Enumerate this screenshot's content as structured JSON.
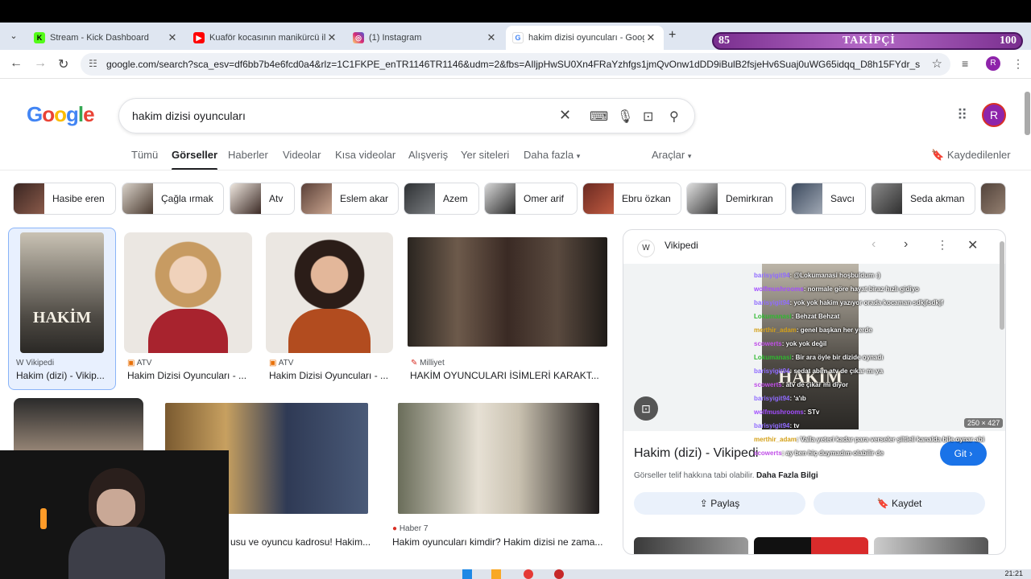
{
  "browser": {
    "tabs": [
      {
        "label": "Stream - Kick Dashboard",
        "icon": "kick-icon",
        "color": "#53fc18"
      },
      {
        "label": "Kuaför kocasının manikürcü ile...",
        "icon": "youtube-icon",
        "color": "#ff0000"
      },
      {
        "label": "(1) Instagram",
        "icon": "instagram-icon",
        "color": "#d6249f"
      },
      {
        "label": "hakim dizisi oyuncuları - Googl...",
        "icon": "google-icon",
        "color": "#4285f4"
      }
    ],
    "url": "google.com/search?sca_esv=df6bb7b4e6fcd0a4&rlz=1C1FKPE_enTR1146TR1146&udm=2&fbs=AIljpHwSU0Xn4FRaYzhfgs1jmQvOnw1dDD9iBulB2fsjeHv6Suaj0uWG65idqq_D8h15FYdr_s8gfpDi9...",
    "profile_initial": "R"
  },
  "follower_overlay": {
    "left": "85",
    "label": "TAKİPÇİ",
    "right": "100",
    "progress": 0.85
  },
  "google": {
    "logo": "Google",
    "query": "hakim dizisi oyuncuları",
    "avatar_initial": "R",
    "filters": [
      "Tümü",
      "Görseller",
      "Haberler",
      "Videolar",
      "Kısa videolar",
      "Alışveriş",
      "Yer siteleri",
      "Daha fazla"
    ],
    "tools": "Araçlar",
    "saved": "Kaydedilenler",
    "chips": [
      "Hasibe eren",
      "Çağla ırmak",
      "Atv",
      "Eslem akar",
      "Azem",
      "Omer arif",
      "Ebru özkan",
      "Demirkıran",
      "Savcı",
      "Seda akman"
    ],
    "results": [
      {
        "source": "Vikipedi",
        "title": "Hakim (dizi) - Vikip..."
      },
      {
        "source": "ATV",
        "title": "Hakim Dizisi Oyuncuları - ..."
      },
      {
        "source": "ATV",
        "title": "Hakim Dizisi Oyuncuları - ..."
      },
      {
        "source": "Milliyet",
        "title": "HAKİM OYUNCULARI İSİMLERİ KARAKT..."
      },
      {
        "source": "",
        "title": "usu ve oyuncu kadrosu! Hakim..."
      },
      {
        "source": "Haber 7",
        "title": "Hakim oyuncuları kimdir? Hakim dizisi ne zama..."
      }
    ]
  },
  "panel": {
    "source": "Vikipedi",
    "dims": "250 × 427",
    "title": "Hakim (dizi) - Vikipedi",
    "copyright": "Görseller telif hakkına tabi olabilir.",
    "more_info": "Daha Fazla Bilgi",
    "go": "Git",
    "share": "Paylaş",
    "save": "Kaydet",
    "poster_text": "HAKİM"
  },
  "chat": [
    {
      "user": "barisyigit94",
      "msg": ": @Lokumanasi hoşbuldum :)",
      "color": "#8f6bff"
    },
    {
      "user": "wolfmushrooms",
      "msg": ": normale göre hayat biraz hızlı gidiyo",
      "color": "#a24cff"
    },
    {
      "user": "barisyigit94",
      "msg": ": yok yok hakim yazıyor orada kocaman sdkjfsdkjf",
      "color": "#8f6bff"
    },
    {
      "user": "Lokumanasi",
      "msg": ": Behzat Behzat",
      "color": "#2fb92f"
    },
    {
      "user": "merthir_adam",
      "msg": ": genel başkan her yerde",
      "color": "#d4a017"
    },
    {
      "user": "scowerts",
      "msg": ": yok yok değil",
      "color": "#c04de8"
    },
    {
      "user": "Lokumanasi",
      "msg": ": Bir ara öyle bir dizide oynadı",
      "color": "#2fb92f"
    },
    {
      "user": "barisyigit94",
      "msg": ": sedat abim atv de çıkar mı ya",
      "color": "#8f6bff"
    },
    {
      "user": "scowerts",
      "msg": ": atv de çıkar mı diyor",
      "color": "#c04de8"
    },
    {
      "user": "barisyigit94",
      "msg": ": 'a'ıb",
      "color": "#8f6bff"
    },
    {
      "user": "wolfmushrooms",
      "msg": ": STv",
      "color": "#a24cff"
    },
    {
      "user": "barisyigit94",
      "msg": ": tv",
      "color": "#8f6bff"
    },
    {
      "user": "merthir_adam",
      "msg": ": Valla yeteri kadar para verseler şiltleli kanalda bile oynar abi",
      "color": "#d4a017"
    },
    {
      "user": "scowerts",
      "msg": ": ay ben hiç duymadım olabilir de",
      "color": "#c04de8"
    }
  ],
  "taskbar": {
    "clock": "21:21"
  },
  "colors": {
    "accent": "#1a73e8",
    "overlay": "#7a2f8f"
  }
}
